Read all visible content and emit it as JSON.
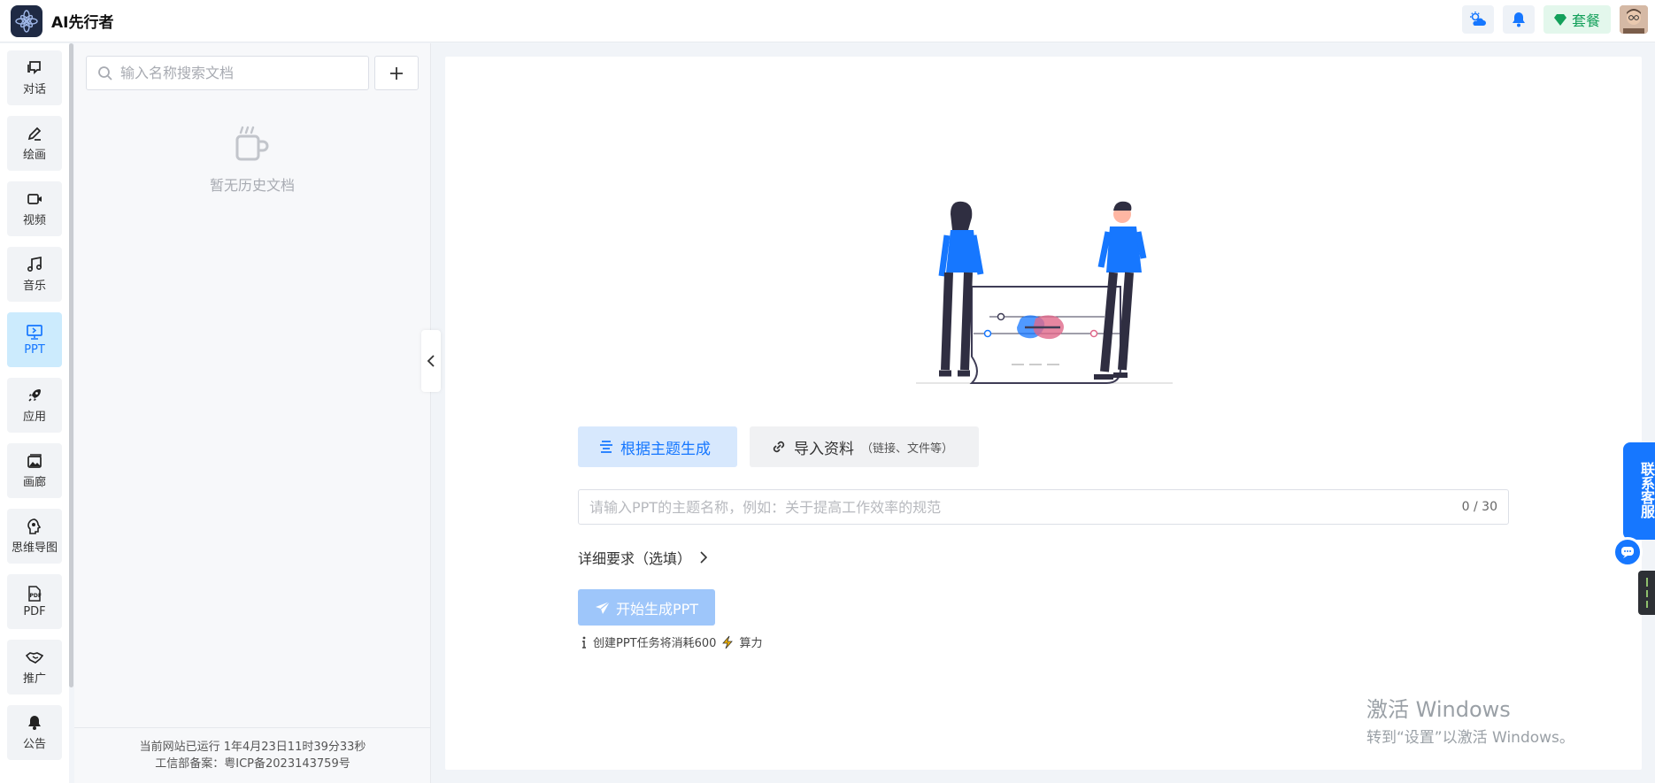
{
  "app": {
    "title": "AI先行者"
  },
  "topbar": {
    "package_label": "套餐"
  },
  "nav": {
    "items": [
      {
        "label": "对话"
      },
      {
        "label": "绘画"
      },
      {
        "label": "视频"
      },
      {
        "label": "音乐"
      },
      {
        "label": "PPT"
      },
      {
        "label": "应用"
      },
      {
        "label": "画廊"
      },
      {
        "label": "思维导图"
      },
      {
        "label": "PDF"
      },
      {
        "label": "推广"
      },
      {
        "label": "公告"
      }
    ],
    "active": "PPT"
  },
  "sidebar": {
    "search_placeholder": "输入名称搜索文档",
    "empty_text": "暂无历史文档",
    "footer_line1": "当前网站已运行 1年4月23日11时39分33秒",
    "footer_line2": "工信部备案：粤ICP备2023143759号"
  },
  "main": {
    "tab_generate": "根据主题生成",
    "tab_import": "导入资料",
    "tab_import_hint": "（链接、文件等）",
    "topic_placeholder": "请输入PPT的主题名称，例如：关于提高工作效率的规范",
    "topic_count": "0 / 30",
    "detail_label": "详细要求（选填）",
    "generate_button": "开始生成PPT",
    "note_prefix": "创建PPT任务将消耗600",
    "note_suffix": "算力"
  },
  "service": {
    "label": "联系客服"
  },
  "watermark": {
    "line1": "激活 Windows",
    "line2": "转到“设置”以激活 Windows。"
  },
  "colors": {
    "accent": "#1677ff",
    "active_nav_bg": "#ccebfd",
    "package_green": "#13a05a",
    "figure_blue": "#1677ff"
  }
}
